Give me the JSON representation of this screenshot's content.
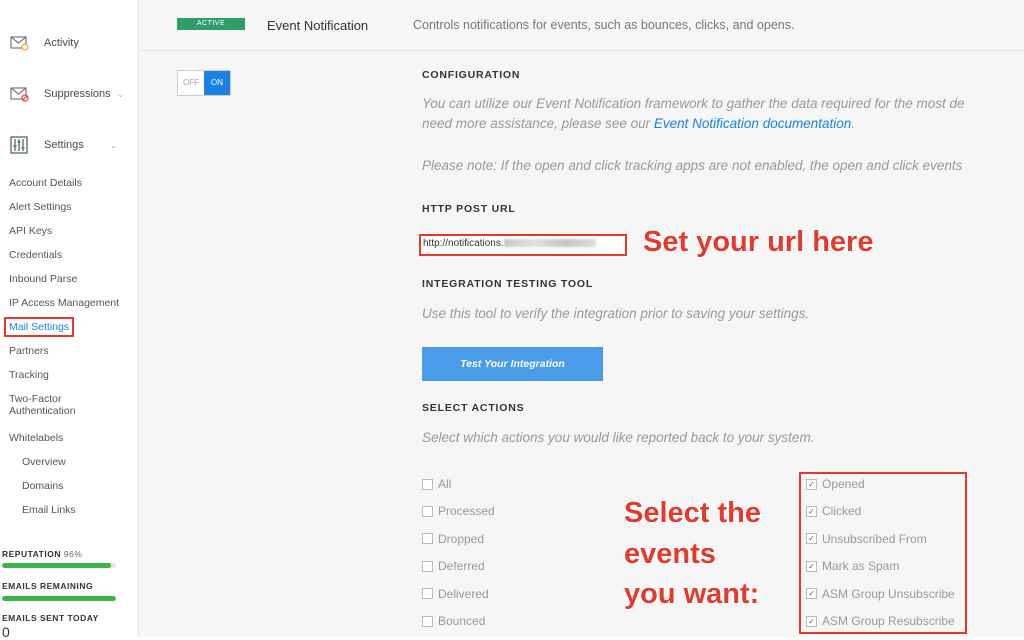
{
  "sidebar": {
    "nav": [
      {
        "label": "Activity",
        "icon": "mail-search-icon"
      },
      {
        "label": "Suppressions",
        "icon": "mail-block-icon"
      },
      {
        "label": "Settings",
        "icon": "sliders-icon"
      }
    ],
    "items": [
      {
        "label": "Account Details"
      },
      {
        "label": "Alert Settings"
      },
      {
        "label": "API Keys"
      },
      {
        "label": "Credentials"
      },
      {
        "label": "Inbound Parse"
      },
      {
        "label": "IP Access Management"
      },
      {
        "label": "Mail Settings"
      },
      {
        "label": "Partners"
      },
      {
        "label": "Tracking"
      },
      {
        "label": "Two-Factor"
      },
      {
        "label": "Authentication"
      },
      {
        "label": "Whitelabels"
      },
      {
        "label": "Overview"
      },
      {
        "label": "Domains"
      },
      {
        "label": "Email Links"
      }
    ],
    "stats": {
      "reputation_label": "REPUTATION",
      "reputation_value": "96%",
      "reputation_fraction": 0.96,
      "emails_remaining_label": "EMAILS REMAINING",
      "emails_remaining_fraction": 1.0,
      "emails_sent_label": "EMAILS SENT TODAY",
      "emails_sent_value": "0"
    }
  },
  "header": {
    "badge": "ACTIVE",
    "title": "Event Notification",
    "description": "Controls notifications for events, such as bounces, clicks, and opens."
  },
  "toggle": {
    "off": "OFF",
    "on": "ON"
  },
  "configuration": {
    "title": "CONFIGURATION",
    "line1": "You can utilize our Event Notification framework to gather the data required for the most de",
    "line2_prefix": "need more assistance, please see our ",
    "line2_link": "Event Notification documentation",
    "line2_suffix": ".",
    "note": "Please note: If the open and click tracking apps are not enabled, the open and click events"
  },
  "http_post": {
    "title": "HTTP POST URL",
    "url_value": "http://notifications."
  },
  "testing": {
    "title": "INTEGRATION TESTING TOOL",
    "desc": "Use this tool to verify the integration prior to saving your settings.",
    "button": "Test Your Integration"
  },
  "actions": {
    "title": "SELECT ACTIONS",
    "desc": "Select which actions you would like reported back to your system.",
    "left": [
      {
        "label": "All",
        "checked": false
      },
      {
        "label": "Processed",
        "checked": false
      },
      {
        "label": "Dropped",
        "checked": false
      },
      {
        "label": "Deferred",
        "checked": false
      },
      {
        "label": "Delivered",
        "checked": false
      },
      {
        "label": "Bounced",
        "checked": false
      }
    ],
    "right": [
      {
        "label": "Opened",
        "checked": true
      },
      {
        "label": "Clicked",
        "checked": true
      },
      {
        "label": "Unsubscribed From",
        "checked": true
      },
      {
        "label": "Mark as Spam",
        "checked": true
      },
      {
        "label": "ASM Group Unsubscribe",
        "checked": true
      },
      {
        "label": "ASM Group Resubscribe",
        "checked": true
      }
    ]
  },
  "annotations": {
    "url": "Set your url here",
    "events_1": "Select the",
    "events_2": "events",
    "events_3": "you want:"
  },
  "colors": {
    "accent": "#1a82e2",
    "annotation": "#e23b2e",
    "active": "#2f9e6b",
    "bar": "#3bb44a"
  }
}
